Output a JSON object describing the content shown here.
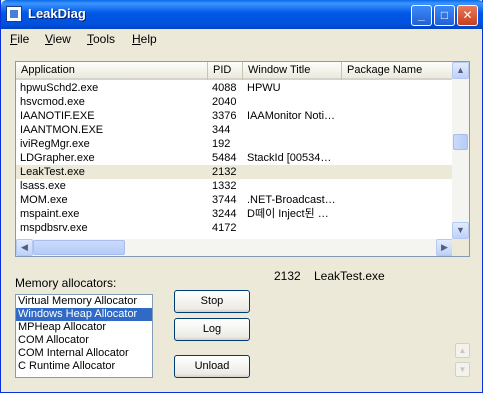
{
  "window": {
    "title": "LeakDiag"
  },
  "menu": [
    {
      "label": "File",
      "accel": "F",
      "rest": "ile"
    },
    {
      "label": "View",
      "accel": "V",
      "rest": "iew"
    },
    {
      "label": "Tools",
      "accel": "T",
      "rest": "ools"
    },
    {
      "label": "Help",
      "accel": "H",
      "rest": "elp"
    }
  ],
  "process_list": {
    "columns": [
      "Application",
      "PID",
      "Window Title",
      "Package Name"
    ],
    "rows": [
      {
        "app": "hpwuSchd2.exe",
        "pid": "4088",
        "title": "HPWU",
        "package": ""
      },
      {
        "app": "hsvcmod.exe",
        "pid": "2040",
        "title": "",
        "package": ""
      },
      {
        "app": "IAANOTIF.EXE",
        "pid": "3376",
        "title": "IAAMonitor Noti…",
        "package": ""
      },
      {
        "app": "IAANTMON.EXE",
        "pid": "344",
        "title": "",
        "package": ""
      },
      {
        "app": "iviRegMgr.exe",
        "pid": "192",
        "title": "",
        "package": ""
      },
      {
        "app": "LDGrapher.exe",
        "pid": "5484",
        "title": "StackId [00534…",
        "package": ""
      },
      {
        "app": "LeakTest.exe",
        "pid": "2132",
        "title": "",
        "package": "",
        "selected": true
      },
      {
        "app": "lsass.exe",
        "pid": "1332",
        "title": "",
        "package": ""
      },
      {
        "app": "MOM.exe",
        "pid": "3744",
        "title": ".NET-Broadcast…",
        "package": ""
      },
      {
        "app": "mspaint.exe",
        "pid": "3244",
        "title": "D떼이 Inject된 …",
        "package": ""
      },
      {
        "app": "mspdbsrv.exe",
        "pid": "4172",
        "title": "",
        "package": ""
      }
    ]
  },
  "memory_allocators": {
    "label": "Memory allocators:",
    "items": [
      {
        "label": "Virtual Memory Allocator"
      },
      {
        "label": "Windows Heap Allocator",
        "selected": true
      },
      {
        "label": "MPHeap Allocator"
      },
      {
        "label": "COM Allocator"
      },
      {
        "label": "COM Internal Allocator"
      },
      {
        "label": "C Runtime Allocator"
      }
    ]
  },
  "status": {
    "pid": "2132",
    "name": "LeakTest.exe"
  },
  "buttons": {
    "stop": "Stop",
    "log": "Log",
    "unload": "Unload"
  }
}
